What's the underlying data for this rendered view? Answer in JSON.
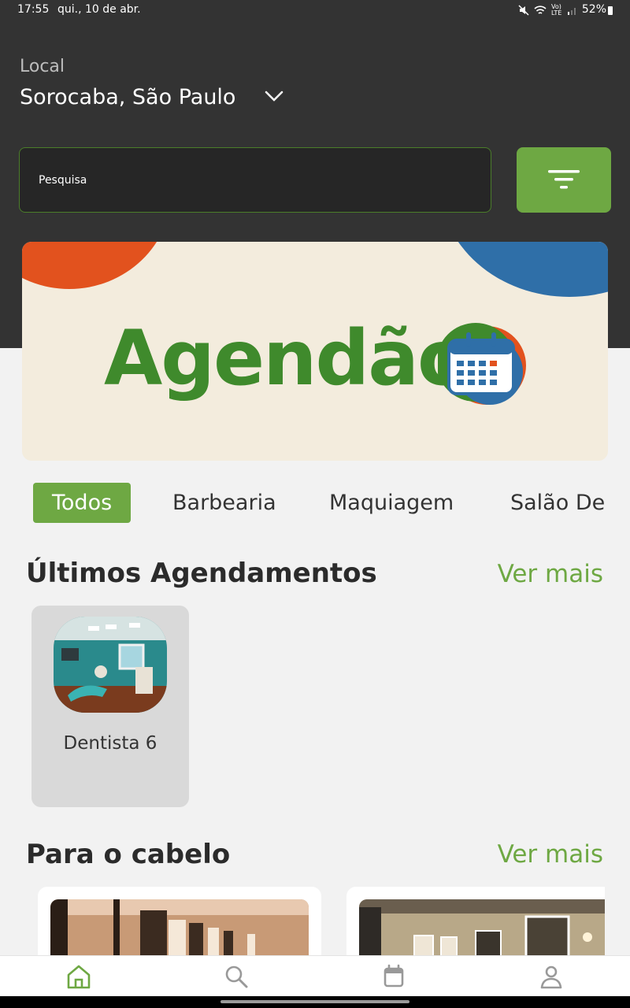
{
  "status_bar": {
    "time": "17:55",
    "date": "qui., 10 de abr.",
    "network": "Vo) LTE",
    "battery": "52%"
  },
  "location": {
    "label": "Local",
    "value": "Sorocaba, São Paulo",
    "icon": "chevron-down-icon"
  },
  "search": {
    "placeholder": "Pesquisa",
    "filter_icon": "filter-icon"
  },
  "banner": {
    "text": "Agendão",
    "logo_icon": "calendar-icon"
  },
  "categories": {
    "items": [
      "Todos",
      "Barbearia",
      "Maquiagem",
      "Salão De"
    ],
    "selected": "Todos"
  },
  "recent": {
    "title": "Últimos Agendamentos",
    "see_more": "Ver mais",
    "items": [
      {
        "name": "Dentista 6"
      }
    ]
  },
  "hair": {
    "title": "Para o cabelo",
    "see_more": "Ver mais"
  },
  "bottom_nav": {
    "items": [
      {
        "icon": "home-icon",
        "active": true
      },
      {
        "icon": "search-icon",
        "active": false
      },
      {
        "icon": "calendar-icon",
        "active": false
      },
      {
        "icon": "profile-icon",
        "active": false
      }
    ]
  },
  "colors": {
    "accent": "#6ea843",
    "header_bg": "#333333",
    "page_bg": "#f2f2f2",
    "card_bg": "#d9d9d9"
  }
}
